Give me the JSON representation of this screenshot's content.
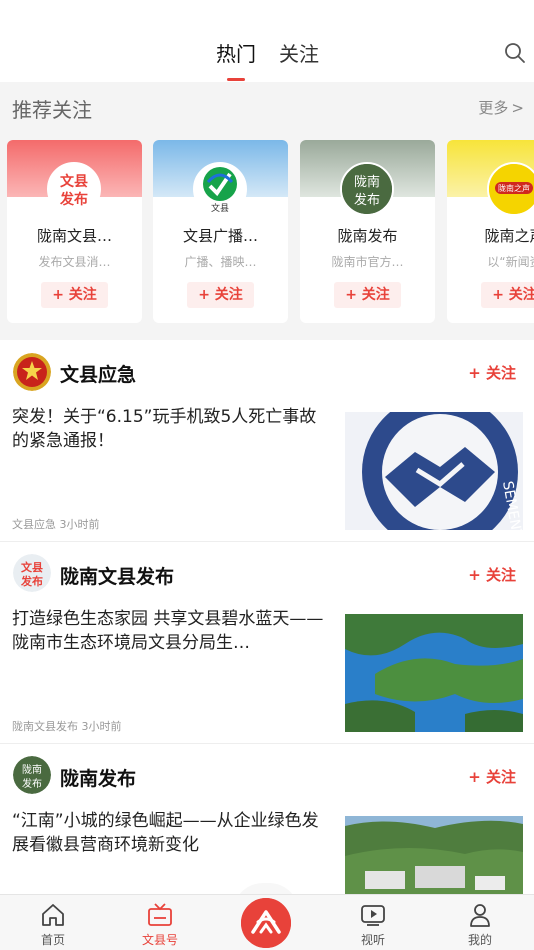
{
  "tabs": {
    "hot": "热门",
    "follow": "关注"
  },
  "recommend": {
    "title": "推荐关注",
    "more": "更多",
    "follow_label": "+ 关注",
    "cards": [
      {
        "name": "陇南文县…",
        "desc": "发布文县消…",
        "avatar_text": "文县发布"
      },
      {
        "name": "文县广播…",
        "desc": "广播、播映…",
        "avatar_text": "文县"
      },
      {
        "name": "陇南发布",
        "desc": "陇南市官方…",
        "avatar_text": "陇南发布"
      },
      {
        "name": "陇南之声",
        "desc": "以“新闻资",
        "avatar_text": "陇南之声"
      }
    ]
  },
  "feed": [
    {
      "account": "文县应急",
      "follow": "+ 关注",
      "title": "突发！关于“6.15”玩手机致5人死亡事故的紧急通报！",
      "meta": "文县应急  3小时前"
    },
    {
      "account": "陇南文县发布",
      "follow": "+ 关注",
      "title": "打造绿色生态家园 共享文县碧水蓝天——陇南市生态环境局文县分局生…",
      "meta": "陇南文县发布  3小时前"
    },
    {
      "account": "陇南发布",
      "follow": "+ 关注",
      "title": "“江南”小城的绿色崛起——从企业绿色发展看徽县营商环境新变化",
      "meta": ""
    }
  ],
  "bottom_nav": {
    "home": "首页",
    "wenxian": "文县号",
    "video": "视听",
    "mine": "我的"
  },
  "colors": {
    "accent": "#e8423a"
  }
}
